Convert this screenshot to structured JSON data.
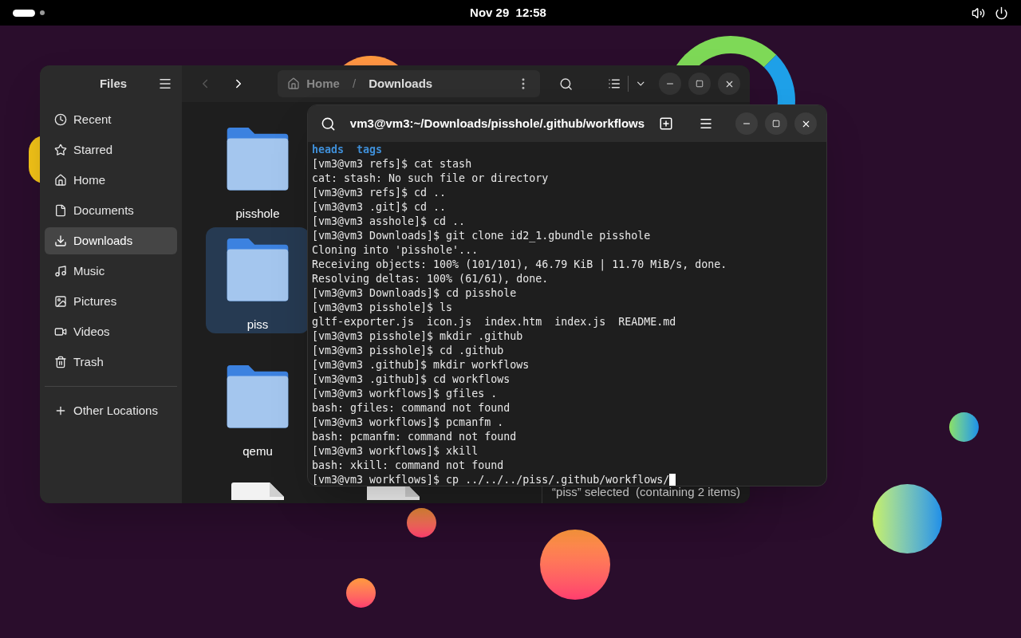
{
  "top_bar": {
    "clock": "Nov 29  12:58"
  },
  "files_window": {
    "title": "Files",
    "sidebar": {
      "items": [
        {
          "label": "Recent",
          "selected": false
        },
        {
          "label": "Starred",
          "selected": false
        },
        {
          "label": "Home",
          "selected": false
        },
        {
          "label": "Documents",
          "selected": false
        },
        {
          "label": "Downloads",
          "selected": true
        },
        {
          "label": "Music",
          "selected": false
        },
        {
          "label": "Pictures",
          "selected": false
        },
        {
          "label": "Videos",
          "selected": false
        },
        {
          "label": "Trash",
          "selected": false
        }
      ],
      "other": {
        "label": "Other Locations",
        "selected": false
      }
    },
    "nav": {
      "back_disabled": true,
      "forward_disabled": false
    },
    "path": [
      {
        "label": "Home",
        "current": false
      },
      {
        "label": "Downloads",
        "current": true
      }
    ],
    "path_separator": "/",
    "rows": [
      [
        {
          "kind": "folder",
          "name": "pisshole",
          "selected": false
        }
      ],
      [
        {
          "kind": "folder",
          "name": "piss",
          "selected": true
        }
      ],
      [
        {
          "kind": "folder",
          "name": "qemu",
          "selected": false
        }
      ],
      [
        {
          "kind": "document",
          "selected": false
        },
        {
          "kind": "document",
          "selected": false
        }
      ]
    ],
    "status": "“piss” selected  (containing 2 items)"
  },
  "terminal": {
    "title": "vm3@vm3:~/Downloads/pisshole/.github/workflows",
    "lines": [
      {
        "kind": "dirs",
        "entries": [
          "heads",
          "tags"
        ]
      },
      {
        "kind": "text",
        "text": "[vm3@vm3 refs]$ cat stash"
      },
      {
        "kind": "text",
        "text": "cat: stash: No such file or directory"
      },
      {
        "kind": "text",
        "text": "[vm3@vm3 refs]$ cd .."
      },
      {
        "kind": "text",
        "text": "[vm3@vm3 .git]$ cd .."
      },
      {
        "kind": "text",
        "text": "[vm3@vm3 asshole]$ cd .."
      },
      {
        "kind": "text",
        "text": "[vm3@vm3 Downloads]$ git clone id2_1.gbundle pisshole"
      },
      {
        "kind": "text",
        "text": "Cloning into 'pisshole'..."
      },
      {
        "kind": "text",
        "text": "Receiving objects: 100% (101/101), 46.79 KiB | 11.70 MiB/s, done."
      },
      {
        "kind": "text",
        "text": "Resolving deltas: 100% (61/61), done."
      },
      {
        "kind": "text",
        "text": "[vm3@vm3 Downloads]$ cd pisshole"
      },
      {
        "kind": "text",
        "text": "[vm3@vm3 pisshole]$ ls"
      },
      {
        "kind": "text",
        "text": "gltf-exporter.js  icon.js  index.htm  index.js  README.md"
      },
      {
        "kind": "text",
        "text": "[vm3@vm3 pisshole]$ mkdir .github"
      },
      {
        "kind": "text",
        "text": "[vm3@vm3 pisshole]$ cd .github"
      },
      {
        "kind": "text",
        "text": "[vm3@vm3 .github]$ mkdir workflows"
      },
      {
        "kind": "text",
        "text": "[vm3@vm3 .github]$ cd workflows"
      },
      {
        "kind": "text",
        "text": "[vm3@vm3 workflows]$ gfiles ."
      },
      {
        "kind": "text",
        "text": "bash: gfiles: command not found"
      },
      {
        "kind": "text",
        "text": "[vm3@vm3 workflows]$ pcmanfm ."
      },
      {
        "kind": "text",
        "text": "bash: pcmanfm: command not found"
      },
      {
        "kind": "text",
        "text": "[vm3@vm3 workflows]$ xkill"
      },
      {
        "kind": "text",
        "text": "bash: xkill: command not found"
      },
      {
        "kind": "input",
        "text": "[vm3@vm3 workflows]$ cp ../../../piss/.github/workflows/",
        "cursor": true
      }
    ]
  }
}
